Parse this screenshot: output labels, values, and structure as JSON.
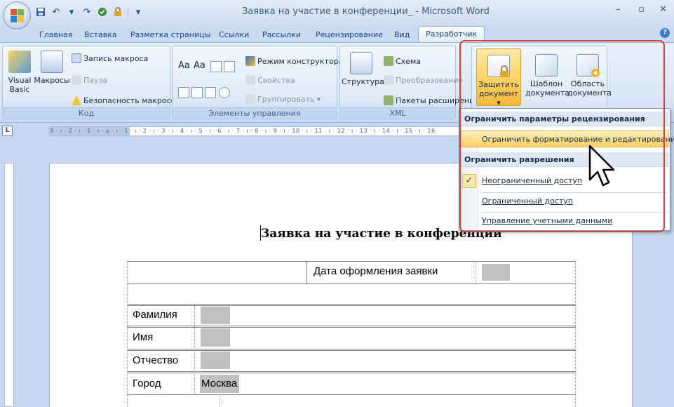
{
  "window": {
    "title": "Заявка на участие в конференции_ - Microsoft Word",
    "controls": {
      "minimize": "–",
      "maximize": "▫",
      "close": "✕"
    }
  },
  "quick_access": {
    "dropdown_symbol": "▾",
    "icons": [
      "save-icon",
      "undo-icon",
      "redo-icon",
      "spell-check-icon",
      "lock-icon",
      "customize-icon"
    ]
  },
  "tabs": [
    {
      "label": "Главная"
    },
    {
      "label": "Вставка"
    },
    {
      "label": "Разметка страницы"
    },
    {
      "label": "Ссылки"
    },
    {
      "label": "Рассылки"
    },
    {
      "label": "Рецензирование"
    },
    {
      "label": "Вид"
    },
    {
      "label": "Разработчик",
      "active": true
    }
  ],
  "help_symbol": "?",
  "ribbon": {
    "code": {
      "label": "Код",
      "visual_basic_line1": "Visual",
      "visual_basic_line2": "Basic",
      "macros": "Макросы",
      "record_macro": "Запись макроса",
      "pause": "Пауза",
      "macro_security": "Безопасность макросов"
    },
    "controls": {
      "label": "Элементы управления",
      "text_aa_1": "Aa",
      "text_aa_2": "Aa",
      "design_mode": "Режим конструктора",
      "properties": "Свойства",
      "group": "Группировать",
      "group_arrow": "▾"
    },
    "xml": {
      "label": "XML",
      "structure": "Структура",
      "schema": "Схема",
      "transform": "Преобразование",
      "expansion_packs": "Пакеты расширения"
    },
    "protect": {
      "protect_line1": "Защитить",
      "protect_line2": "документ",
      "protect_arrow": "▾",
      "template_line1": "Шаблон",
      "template_line2": "документа",
      "panel_line1": "Область",
      "panel_line2": "документа"
    }
  },
  "ruler": {
    "corner_symbol": "L",
    "ticks": "3 · ı · 2 · ı · 1 · ı · ⌂ · ı · 1 · ı · 2 · ı · 3 · ı · 4 · ı · 5 · ı · 6 · ı · 7 · ı · 8 · ı · 9 · ı · 10 · ı · 11 · ı · 12 · ı · 13 · ı · 14 · ı · 15 · ı · 16"
  },
  "dropdown": {
    "header_review": "Ограничить параметры рецензирования",
    "restrict_formatting": "Ограничить форматирование и редактирование",
    "header_permissions": "Ограничить разрешения",
    "unrestricted_access": "Неограниченный доступ",
    "restricted_access": "Ограниченный доступ",
    "manage_credentials": "Управление учетными данными",
    "check_symbol": "✓"
  },
  "document": {
    "title": "Заявка на участие в конференции",
    "date_label": "Дата оформления заявки",
    "surname_label": "Фамилия",
    "name_label": "Имя",
    "patronymic_label": "Отчество",
    "city_label": "Город",
    "city_value": "Москва"
  },
  "colors": {
    "highlight_frame": "#e43a2f",
    "ribbon_blue": "#dbe7f6",
    "hover_gold": "#fcd06a",
    "field_gray": "#c0c0c0"
  }
}
